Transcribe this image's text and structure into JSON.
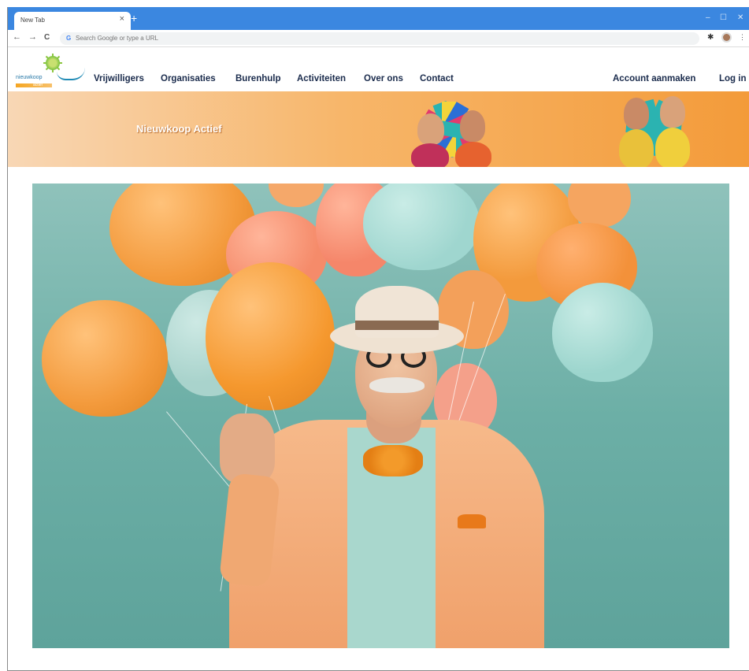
{
  "browser": {
    "tab_title": "New Tab",
    "tab_close": "×",
    "new_tab": "+",
    "window_controls": [
      "–",
      "☐",
      "✕"
    ],
    "nav_buttons": [
      "←",
      "→",
      "C"
    ],
    "omnibox_placeholder": "Search Google or type a URL",
    "omnibox_icon": "G",
    "menu_glyph": "⋮"
  },
  "site": {
    "logo_text": "nieuwkoop",
    "logo_tag": "actief",
    "nav": [
      "Vrijwilligers",
      "Organisaties",
      "Burenhulp",
      "Activiteiten",
      "Over ons",
      "Contact"
    ],
    "account_create": "Account aanmaken",
    "login": "Log in",
    "banner_title": "Nieuwkoop Actief"
  },
  "colors": {
    "browser_tab_bar": "#3b87e0",
    "nav_text": "#1a2b4c",
    "banner_orange": "#f39b3a",
    "hero_teal": "#6cafa6"
  },
  "icons": [
    "back-icon",
    "forward-icon",
    "reload-icon",
    "google-icon",
    "extensions-icon",
    "profile-icon",
    "menu-icon",
    "close-icon",
    "plus-icon"
  ]
}
